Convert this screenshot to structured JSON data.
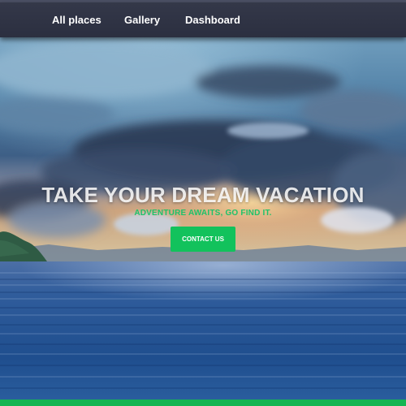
{
  "nav": {
    "items": [
      {
        "label": "All places"
      },
      {
        "label": "Gallery"
      },
      {
        "label": "Dashboard"
      }
    ]
  },
  "hero": {
    "title": "TAKE YOUR DREAM VACATION",
    "subtitle": "ADVENTURE AWAITS, GO FIND IT.",
    "button_label": "CONTACT US"
  },
  "colors": {
    "navbar": "#2f3245",
    "accent": "#12c25c",
    "subtitle": "#1ec26a",
    "title": "#ffffff"
  }
}
